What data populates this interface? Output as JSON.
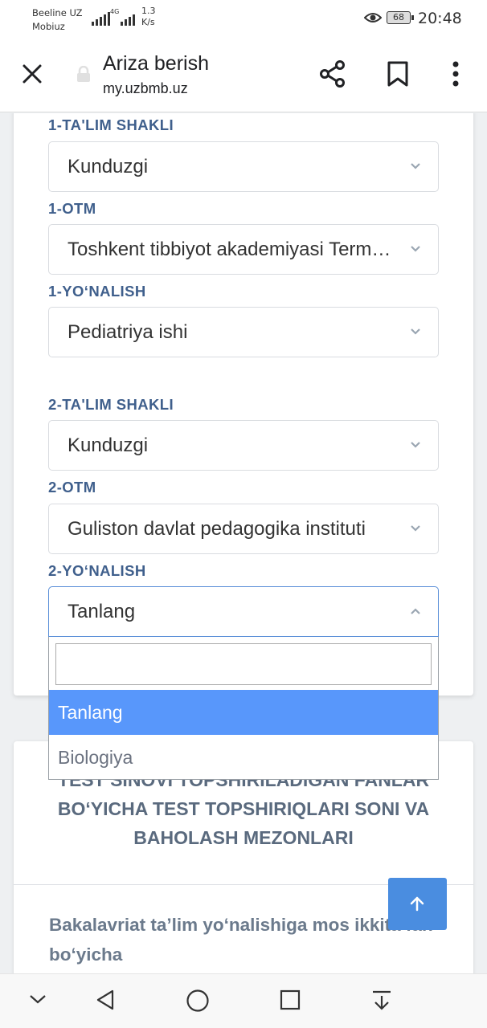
{
  "status": {
    "carrier1": "Beeline UZ",
    "carrier2": "Mobiuz",
    "net_label": "4G",
    "speed_value": "1.3",
    "speed_unit": "K/s",
    "battery": "68",
    "time": "20:48"
  },
  "browser": {
    "title": "Ariza berish",
    "url": "my.uzbmb.uz"
  },
  "form": {
    "f1_label": "1-TA'LIM SHAKLI",
    "f1_value": "Kunduzgi",
    "f2_label": "1-OTM",
    "f2_value": "Toshkent tibbiyot akademiyasi Termiz filiali",
    "f3_label": "1-YO‘NALISH",
    "f3_value": "Pediatriya ishi",
    "f4_label": "2-TA'LIM SHAKLI",
    "f4_value": "Kunduzgi",
    "f5_label": "2-OTM",
    "f5_value": "Guliston davlat pedagogika instituti",
    "f6_label": "2-YO‘NALISH",
    "f6_value": "Tanlang"
  },
  "dropdown": {
    "search_value": "",
    "options": [
      "Tanlang",
      "Biologiya"
    ]
  },
  "info": {
    "heading": "TEST SINOVI TOPSHIRILADIGAN FANLAR BO‘YICHA TEST TOPSHIRIQLARI SONI VA BAHOLASH MEZONLARI",
    "body": "Bakalavriat ta’lim yo‘nalishiga mos ikkita fan bo‘yicha"
  },
  "colors": {
    "label": "#3f5f8c",
    "accent": "#5897fb",
    "scroll_button": "#4a8de0"
  },
  "icons": [
    "close-icon",
    "lock-icon",
    "share-icon",
    "bookmark-icon",
    "more-icon",
    "chevron-down-icon",
    "chevron-up-icon",
    "arrow-up-icon",
    "eye-icon",
    "nav-collapse-icon",
    "nav-back-icon",
    "nav-home-icon",
    "nav-recents-icon",
    "nav-download-icon"
  ]
}
